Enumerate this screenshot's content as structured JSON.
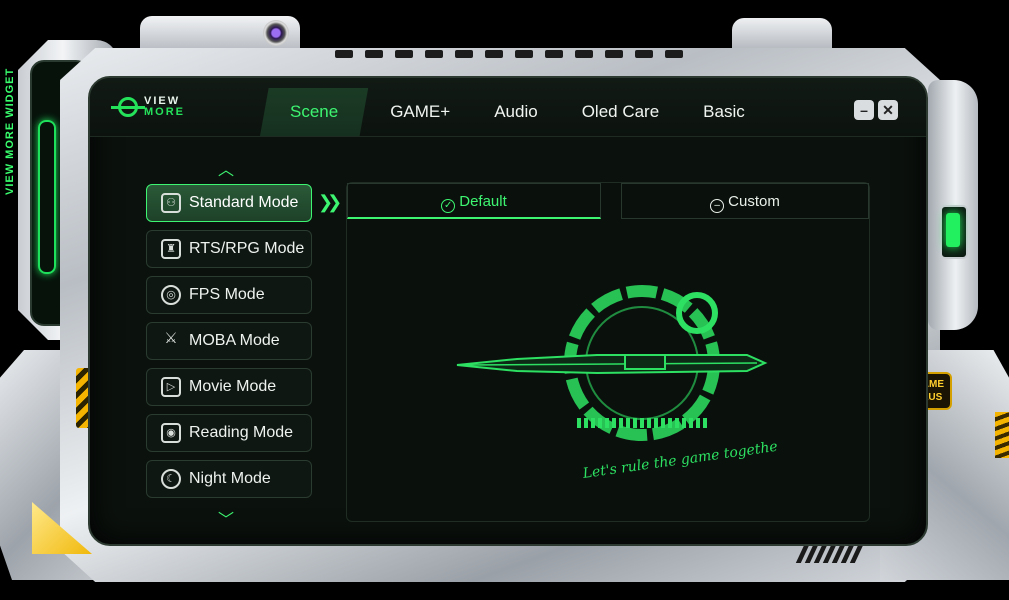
{
  "window": {
    "side_label": "VIEW MORE WIDGET",
    "badge": "GAME PLUS",
    "logo": {
      "line1": "VIEW",
      "line2": "MORE"
    }
  },
  "topbar": {
    "tabs": [
      {
        "label": "Scene",
        "active": true
      },
      {
        "label": "GAME+",
        "active": false
      },
      {
        "label": "Audio",
        "active": false
      },
      {
        "label": "Oled Care",
        "active": false
      },
      {
        "label": "Basic",
        "active": false
      }
    ],
    "minimize_label": "–",
    "close_label": "✕"
  },
  "sidebar": {
    "items": [
      {
        "label": "Standard Mode",
        "icon": "standard-icon",
        "active": true
      },
      {
        "label": "RTS/RPG Mode",
        "icon": "rts-icon",
        "active": false
      },
      {
        "label": "FPS Mode",
        "icon": "target-icon",
        "active": false
      },
      {
        "label": "MOBA Mode",
        "icon": "swords-icon",
        "active": false
      },
      {
        "label": "Movie Mode",
        "icon": "movie-icon",
        "active": false
      },
      {
        "label": "Reading Mode",
        "icon": "book-icon",
        "active": false
      },
      {
        "label": "Night Mode",
        "icon": "moon-icon",
        "active": false
      }
    ]
  },
  "panel": {
    "default_label": "Default",
    "custom_label": "Custom",
    "emblem_text": "Let's rule the game together!"
  },
  "colors": {
    "accent": "#3df571",
    "screen": "#0b110d",
    "badge_yellow": "#ffcf2e"
  }
}
